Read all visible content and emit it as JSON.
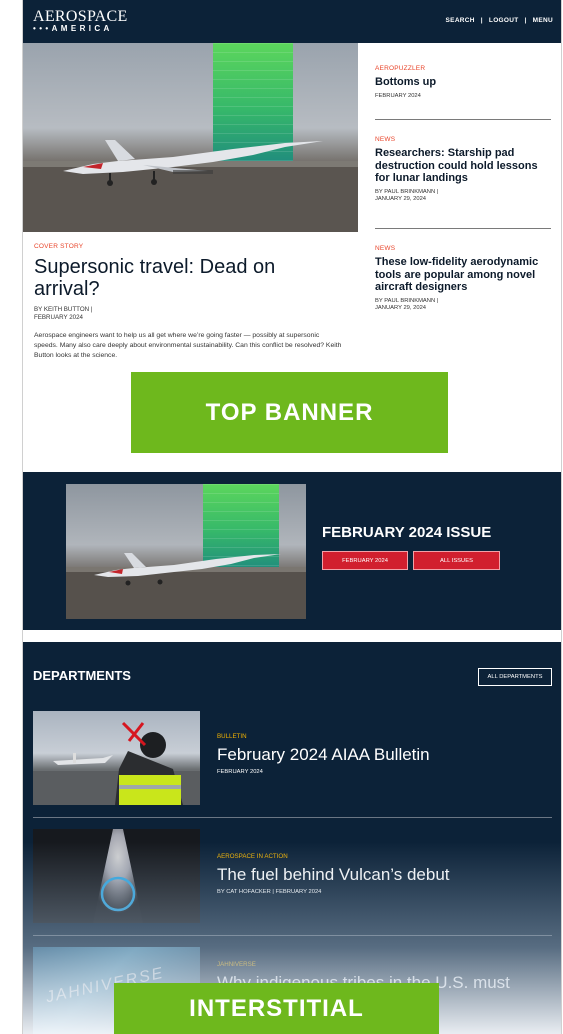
{
  "header": {
    "logo_line1": "AEROSPACE",
    "logo_line2": "•••AMERICA",
    "nav": [
      "SEARCH",
      "|",
      "LOGOUT",
      "|",
      "MENU"
    ]
  },
  "cover_story": {
    "kicker": "COVER STORY",
    "title": "Supersonic travel: Dead on arrival?",
    "byline": "BY KEITH BUTTON |",
    "date": "FEBRUARY 2024",
    "description": "Aerospace engineers want to help us all get where we’re going faster — possibly at supersonic speeds. Many also care deeply about environmental sustainability. Can this conflict be resolved? Keith Button looks at the science."
  },
  "side_items": [
    {
      "kicker": "AEROPUZZLER",
      "title": "Bottoms up",
      "byline": "",
      "date": "FEBRUARY 2024"
    },
    {
      "kicker": "NEWS",
      "title": "Researchers: Starship pad destruction could hold lessons for lunar landings",
      "byline": "BY PAUL BRINKMANN |",
      "date": "JANUARY 29, 2024"
    },
    {
      "kicker": "NEWS",
      "title": "These low-fidelity aerodynamic tools are popular among novel aircraft designers",
      "byline": "BY PAUL BRINKMANN |",
      "date": "JANUARY 29, 2024"
    }
  ],
  "top_banner": "TOP BANNER",
  "issue": {
    "title": "FEBRUARY 2024 ISSUE",
    "btn_current": "FEBRUARY 2024",
    "btn_all": "ALL ISSUES"
  },
  "departments": {
    "heading": "DEPARTMENTS",
    "all_button": "ALL DEPARTMENTS",
    "items": [
      {
        "kicker": "BULLETIN",
        "title": "February 2024 AIAA Bulletin",
        "meta": "FEBRUARY 2024"
      },
      {
        "kicker": "AEROSPACE IN ACTION",
        "title": "The fuel behind Vulcan’s debut",
        "meta": "BY CAT HOFACKER | FEBRUARY 2024"
      },
      {
        "kicker": "JAHNIVERSE",
        "title": "Why indigenous tribes in the U.S. must",
        "meta": ""
      }
    ],
    "jahniverse_image_text": "JAHNIVERSE"
  },
  "interstitial": "INTERSTITIAL",
  "colors": {
    "navy": "#0c2238",
    "accent_red": "#d11f2e",
    "kicker_orange": "#e8442a",
    "banner_green": "#6eb81d",
    "dept_kicker": "#f3b300"
  }
}
